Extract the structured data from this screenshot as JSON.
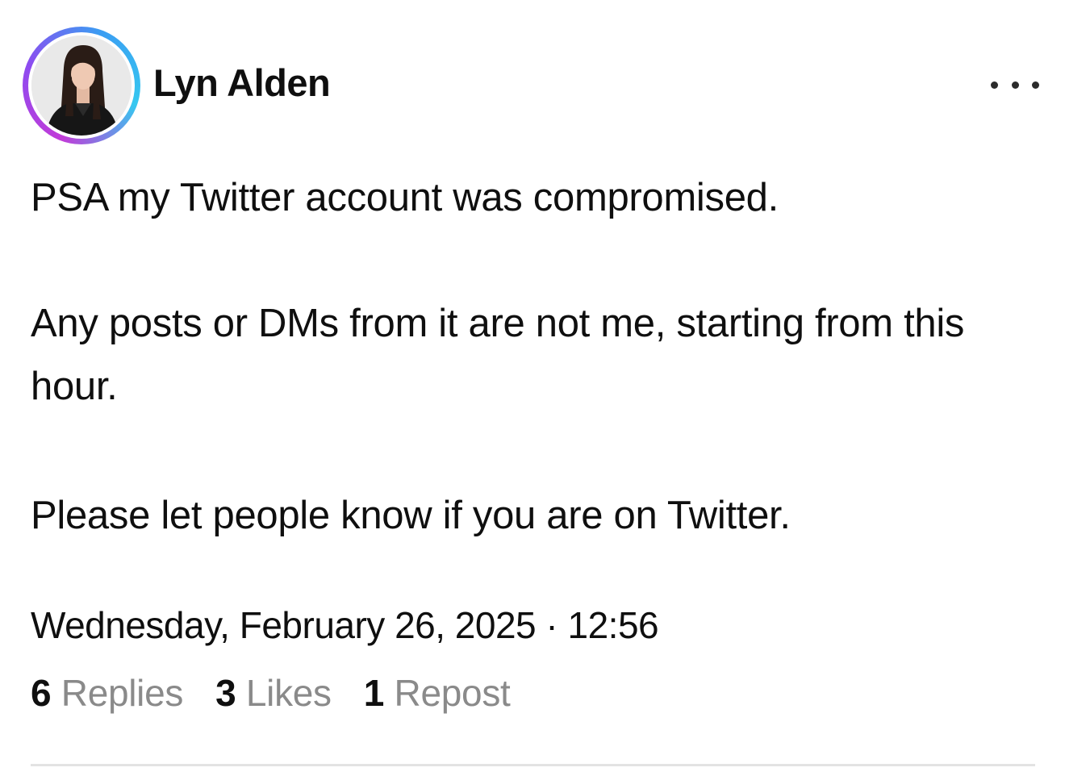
{
  "post": {
    "author": {
      "name": "Lyn Alden"
    },
    "more_icon": "more-horizontal-icon",
    "paragraphs": [
      "PSA my Twitter account was compromised.",
      "Any posts or DMs from it are not me, starting from this hour.",
      "Please let people know if you are on Twitter."
    ],
    "timestamp": "Wednesday, February 26, 2025 · 12:56",
    "stats": {
      "replies": {
        "count": "6",
        "label": "Replies"
      },
      "likes": {
        "count": "3",
        "label": "Likes"
      },
      "reposts": {
        "count": "1",
        "label": "Repost"
      }
    }
  },
  "colors": {
    "avatar_ring_gradient": [
      "#c13bd8",
      "#8e4bf0",
      "#3a9df2",
      "#36c8f0"
    ],
    "stat_label": "#8a8a8a",
    "text": "#0f0f0f"
  }
}
